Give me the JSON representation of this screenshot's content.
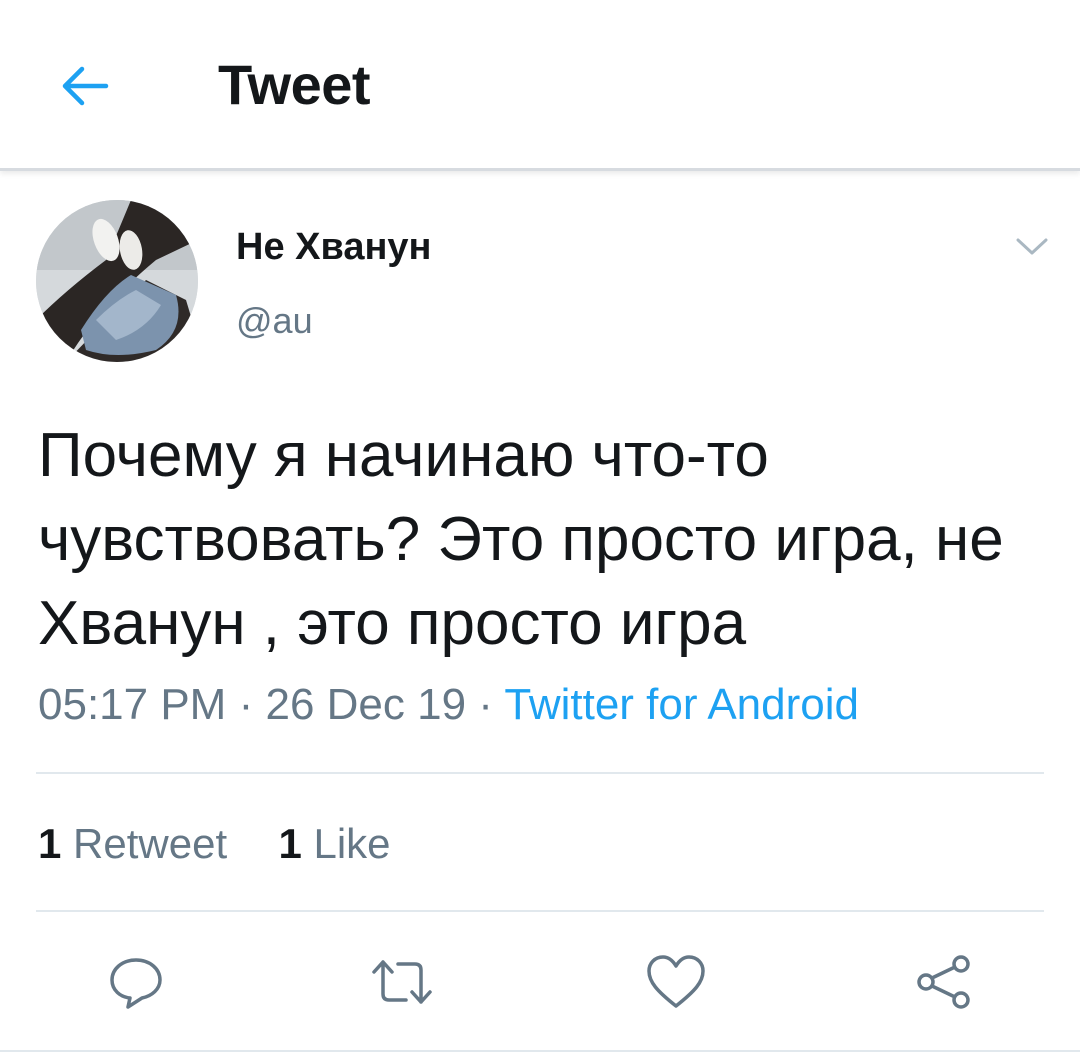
{
  "header": {
    "title": "Tweet",
    "back_icon": "arrow-left-icon",
    "accent_color": "#1da1f2"
  },
  "tweet": {
    "display_name": "Не Хванун",
    "handle": "@au",
    "text": "Почему я начинаю что-то чувствовать? Это просто игра, не Хванун , это просто игра",
    "time": "05:17 PM",
    "date": "26 Dec 19",
    "separator": "·",
    "source": "Twitter for Android",
    "menu_icon": "chevron-down-icon"
  },
  "stats": {
    "retweets_count": "1",
    "retweets_label": "Retweet",
    "likes_count": "1",
    "likes_label": "Like"
  },
  "actions": [
    {
      "name": "reply",
      "icon": "reply-icon"
    },
    {
      "name": "retweet",
      "icon": "retweet-icon"
    },
    {
      "name": "like",
      "icon": "heart-icon"
    },
    {
      "name": "share",
      "icon": "share-icon"
    }
  ],
  "colors": {
    "text_primary": "#14171a",
    "text_secondary": "#657786",
    "link": "#1da1f2",
    "divider": "#e1e8ed"
  }
}
